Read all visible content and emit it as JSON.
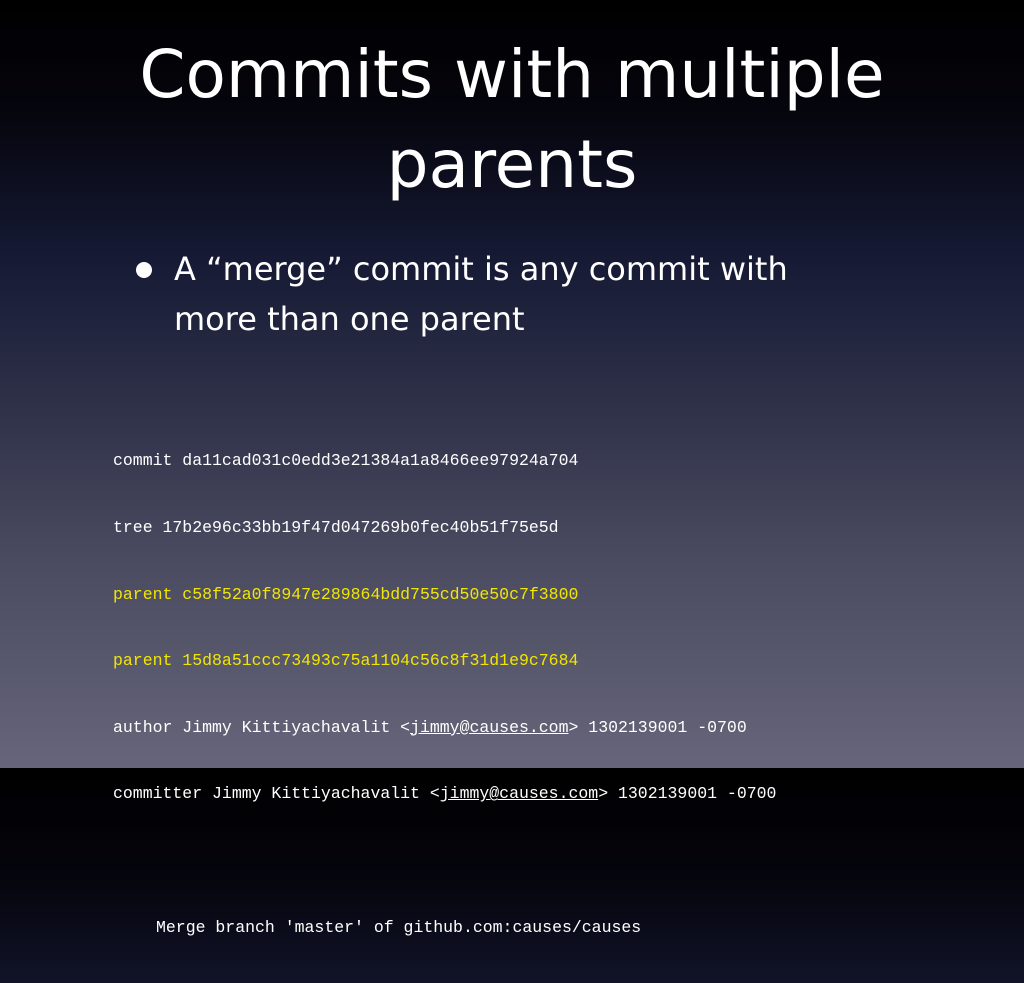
{
  "slide": {
    "title_line1": "Commits with multiple",
    "title_line2": "parents",
    "bullet": {
      "line1": "A “merge” commit is any commit with",
      "line2": "more than one parent"
    },
    "commit": {
      "commit_line": "commit da11cad031c0edd3e21384a1a8466ee97924a704",
      "tree_line": "tree 17b2e96c33bb19f47d047269b0fec40b51f75e5d",
      "parent1_line": "parent c58f52a0f8947e289864bdd755cd50e50c7f3800",
      "parent2_line": "parent 15d8a51ccc73493c75a1104c56c8f31d1e9c7684",
      "author_prefix": "author Jimmy Kittiyachavalit <",
      "author_email": "jimmy@causes.com",
      "author_suffix": "> 1302139001 -0700",
      "committer_prefix": "committer Jimmy Kittiyachavalit <",
      "committer_email": "jimmy@causes.com",
      "committer_suffix": "> 1302139001 -0700",
      "message": "Merge branch 'master' of github.com:causes/causes"
    },
    "colors": {
      "highlight": "#f2e600",
      "text": "#ffffff"
    }
  }
}
